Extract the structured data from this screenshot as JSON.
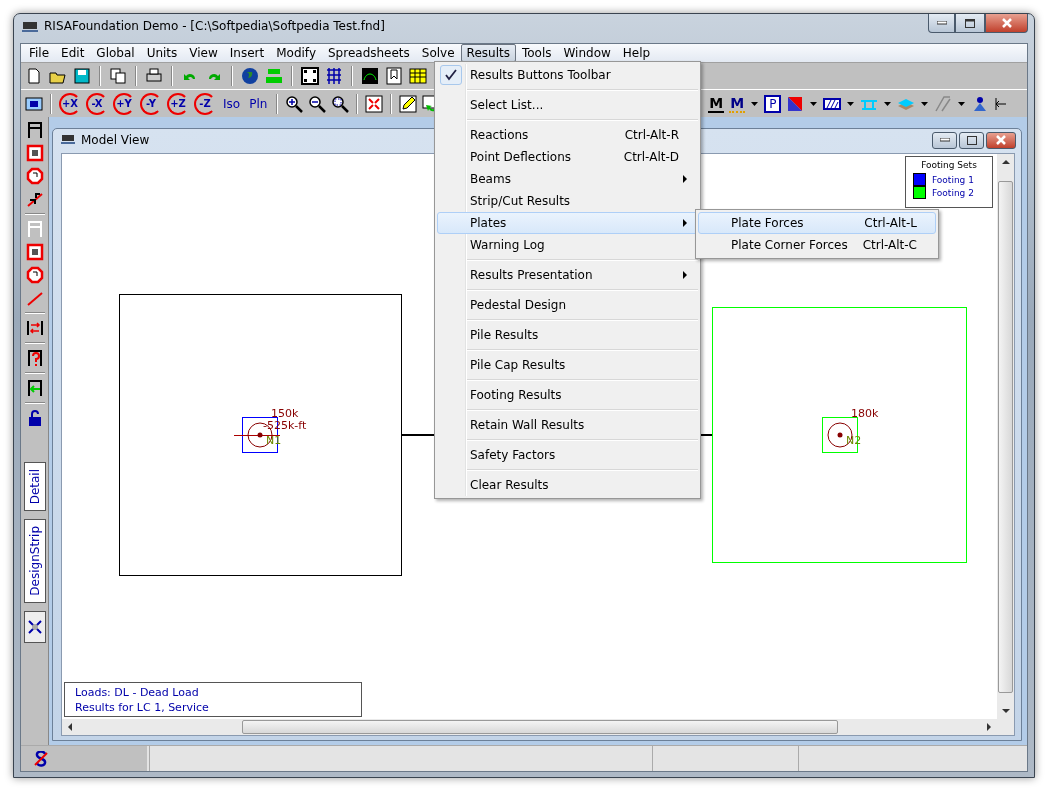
{
  "window": {
    "title": "RISAFoundation Demo - [C:\\Softpedia\\Softpedia Test.fnd]"
  },
  "menu_bar": [
    {
      "label": "File",
      "selected": false
    },
    {
      "label": "Edit",
      "selected": false
    },
    {
      "label": "Global",
      "selected": false
    },
    {
      "label": "Units",
      "selected": false
    },
    {
      "label": "View",
      "selected": false
    },
    {
      "label": "Insert",
      "selected": false
    },
    {
      "label": "Modify",
      "selected": false
    },
    {
      "label": "Spreadsheets",
      "selected": false
    },
    {
      "label": "Solve",
      "selected": false
    },
    {
      "label": "Results",
      "selected": true
    },
    {
      "label": "Tools",
      "selected": false
    },
    {
      "label": "Window",
      "selected": false
    },
    {
      "label": "Help",
      "selected": false
    }
  ],
  "view_toolbar": {
    "buttons": [
      "+X",
      "-X",
      "+Y",
      "-Y",
      "+Z",
      "-Z",
      "Iso",
      "Pln"
    ],
    "results_buttons": [
      "M",
      "M",
      "P"
    ]
  },
  "left_toolbar": {
    "tabs": [
      "Detail",
      "DesignStrip"
    ]
  },
  "model_view": {
    "title": "Model View",
    "legend": {
      "title": "Footing Sets",
      "items": [
        {
          "label": "Footing 1",
          "color": "#0000ff"
        },
        {
          "label": "Footing 2",
          "color": "#00ff00"
        }
      ]
    },
    "footings": [
      {
        "color": "#000000",
        "node": {
          "label": "N1",
          "color": "#0000ff",
          "loads": [
            "150k",
            "-525k-ft"
          ]
        }
      },
      {
        "color": "#00ff00",
        "node": {
          "label": "N2",
          "color": "#00ff00",
          "loads": [
            "180k"
          ]
        }
      }
    ],
    "info": [
      "Loads: DL - Dead Load",
      "Results for LC 1, Service"
    ]
  },
  "results_menu": {
    "items": [
      {
        "kind": "item",
        "label": "Results Buttons Toolbar",
        "checked": true,
        "selected": false,
        "submenu": false
      },
      {
        "kind": "separator"
      },
      {
        "kind": "item",
        "label": "Select List...",
        "checked": false,
        "selected": false,
        "submenu": false
      },
      {
        "kind": "separator"
      },
      {
        "kind": "item",
        "label": "Reactions",
        "shortcut": "Ctrl-Alt-R",
        "checked": false,
        "selected": false,
        "submenu": false
      },
      {
        "kind": "item",
        "label": "Point Deflections",
        "shortcut": "Ctrl-Alt-D",
        "checked": false,
        "selected": false,
        "submenu": false
      },
      {
        "kind": "item",
        "label": "Beams",
        "checked": false,
        "selected": false,
        "submenu": true
      },
      {
        "kind": "item",
        "label": "Strip/Cut Results",
        "checked": false,
        "selected": false,
        "submenu": false
      },
      {
        "kind": "item",
        "label": "Plates",
        "checked": false,
        "selected": true,
        "submenu": true
      },
      {
        "kind": "item",
        "label": "Warning Log",
        "checked": false,
        "selected": false,
        "submenu": false
      },
      {
        "kind": "separator"
      },
      {
        "kind": "item",
        "label": "Results Presentation",
        "checked": false,
        "selected": false,
        "submenu": true
      },
      {
        "kind": "separator"
      },
      {
        "kind": "item",
        "label": "Pedestal Design",
        "checked": false,
        "selected": false,
        "submenu": false
      },
      {
        "kind": "separator"
      },
      {
        "kind": "item",
        "label": "Pile Results",
        "checked": false,
        "selected": false,
        "submenu": false
      },
      {
        "kind": "separator"
      },
      {
        "kind": "item",
        "label": "Pile Cap Results",
        "checked": false,
        "selected": false,
        "submenu": false
      },
      {
        "kind": "separator"
      },
      {
        "kind": "item",
        "label": "Footing Results",
        "checked": false,
        "selected": false,
        "submenu": false
      },
      {
        "kind": "separator"
      },
      {
        "kind": "item",
        "label": "Retain Wall Results",
        "checked": false,
        "selected": false,
        "submenu": false
      },
      {
        "kind": "separator"
      },
      {
        "kind": "item",
        "label": "Safety Factors",
        "checked": false,
        "selected": false,
        "submenu": false
      },
      {
        "kind": "separator"
      },
      {
        "kind": "item",
        "label": "Clear Results",
        "checked": false,
        "selected": false,
        "submenu": false
      }
    ]
  },
  "plates_submenu": {
    "items": [
      {
        "label": "Plate Forces",
        "shortcut": "Ctrl-Alt-L",
        "selected": true
      },
      {
        "label": "Plate Corner Forces",
        "shortcut": "Ctrl-Alt-C",
        "selected": false
      }
    ]
  }
}
